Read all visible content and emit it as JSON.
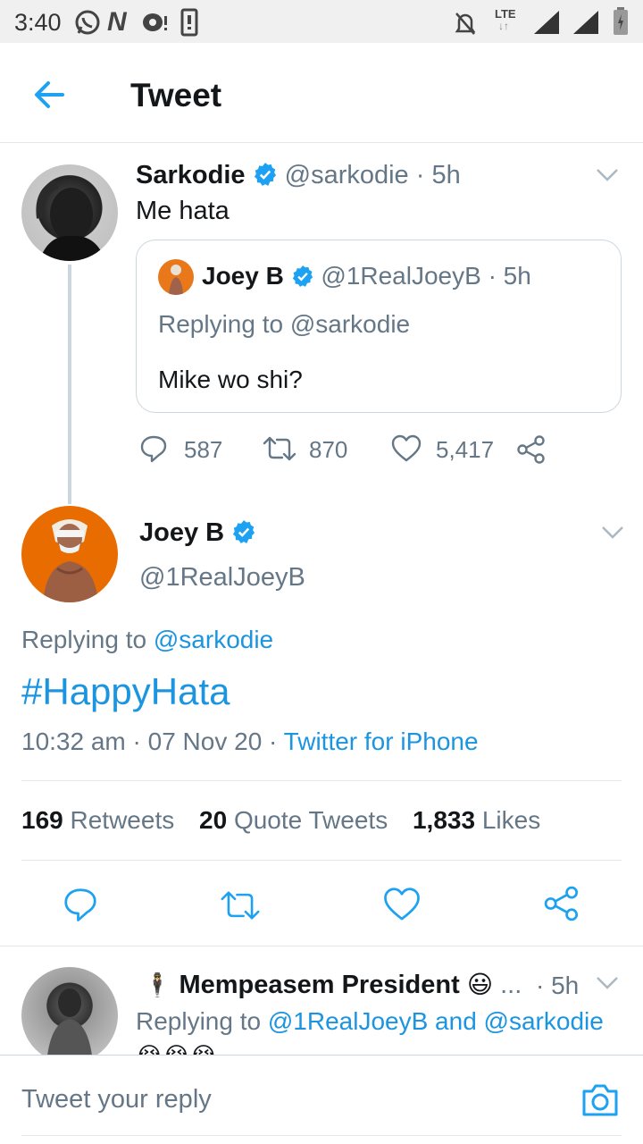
{
  "status_bar": {
    "time": "3:40",
    "network": "LTE"
  },
  "header": {
    "title": "Tweet"
  },
  "parent_tweet": {
    "name": "Sarkodie",
    "handle": "@sarkodie",
    "time": "· 5h",
    "text": "Me hata",
    "quote": {
      "name": "Joey B",
      "handle": "@1RealJoeyB",
      "time": "· 5h",
      "replying": "Replying to @sarkodie",
      "text": "Mike wo shi?"
    },
    "replies": "587",
    "retweets": "870",
    "likes": "5,417"
  },
  "main_tweet": {
    "name": "Joey B",
    "handle": "@1RealJoeyB",
    "replying_prefix": "Replying to ",
    "replying_handle": "@sarkodie",
    "text": "#HappyHata",
    "time": "10:32 am",
    "date": "· 07 Nov 20 ·",
    "source": "Twitter for iPhone",
    "stats": {
      "retweets_count": "169",
      "retweets_label": "Retweets",
      "quotes_count": "20",
      "quotes_label": "Quote Tweets",
      "likes_count": "1,833",
      "likes_label": "Likes"
    }
  },
  "reply_tweet": {
    "name": "Mempeasem President",
    "ellipsis": "...",
    "time": "· 5h",
    "replying_prefix": "Replying to ",
    "replying_handles": "@1RealJoeyB and @sarkodie"
  },
  "reply_bar": {
    "placeholder": "Tweet your reply"
  },
  "colors": {
    "accent": "#1b95e0",
    "text": "#14171a",
    "secondary": "#657786",
    "verified": "#1da1f2"
  }
}
